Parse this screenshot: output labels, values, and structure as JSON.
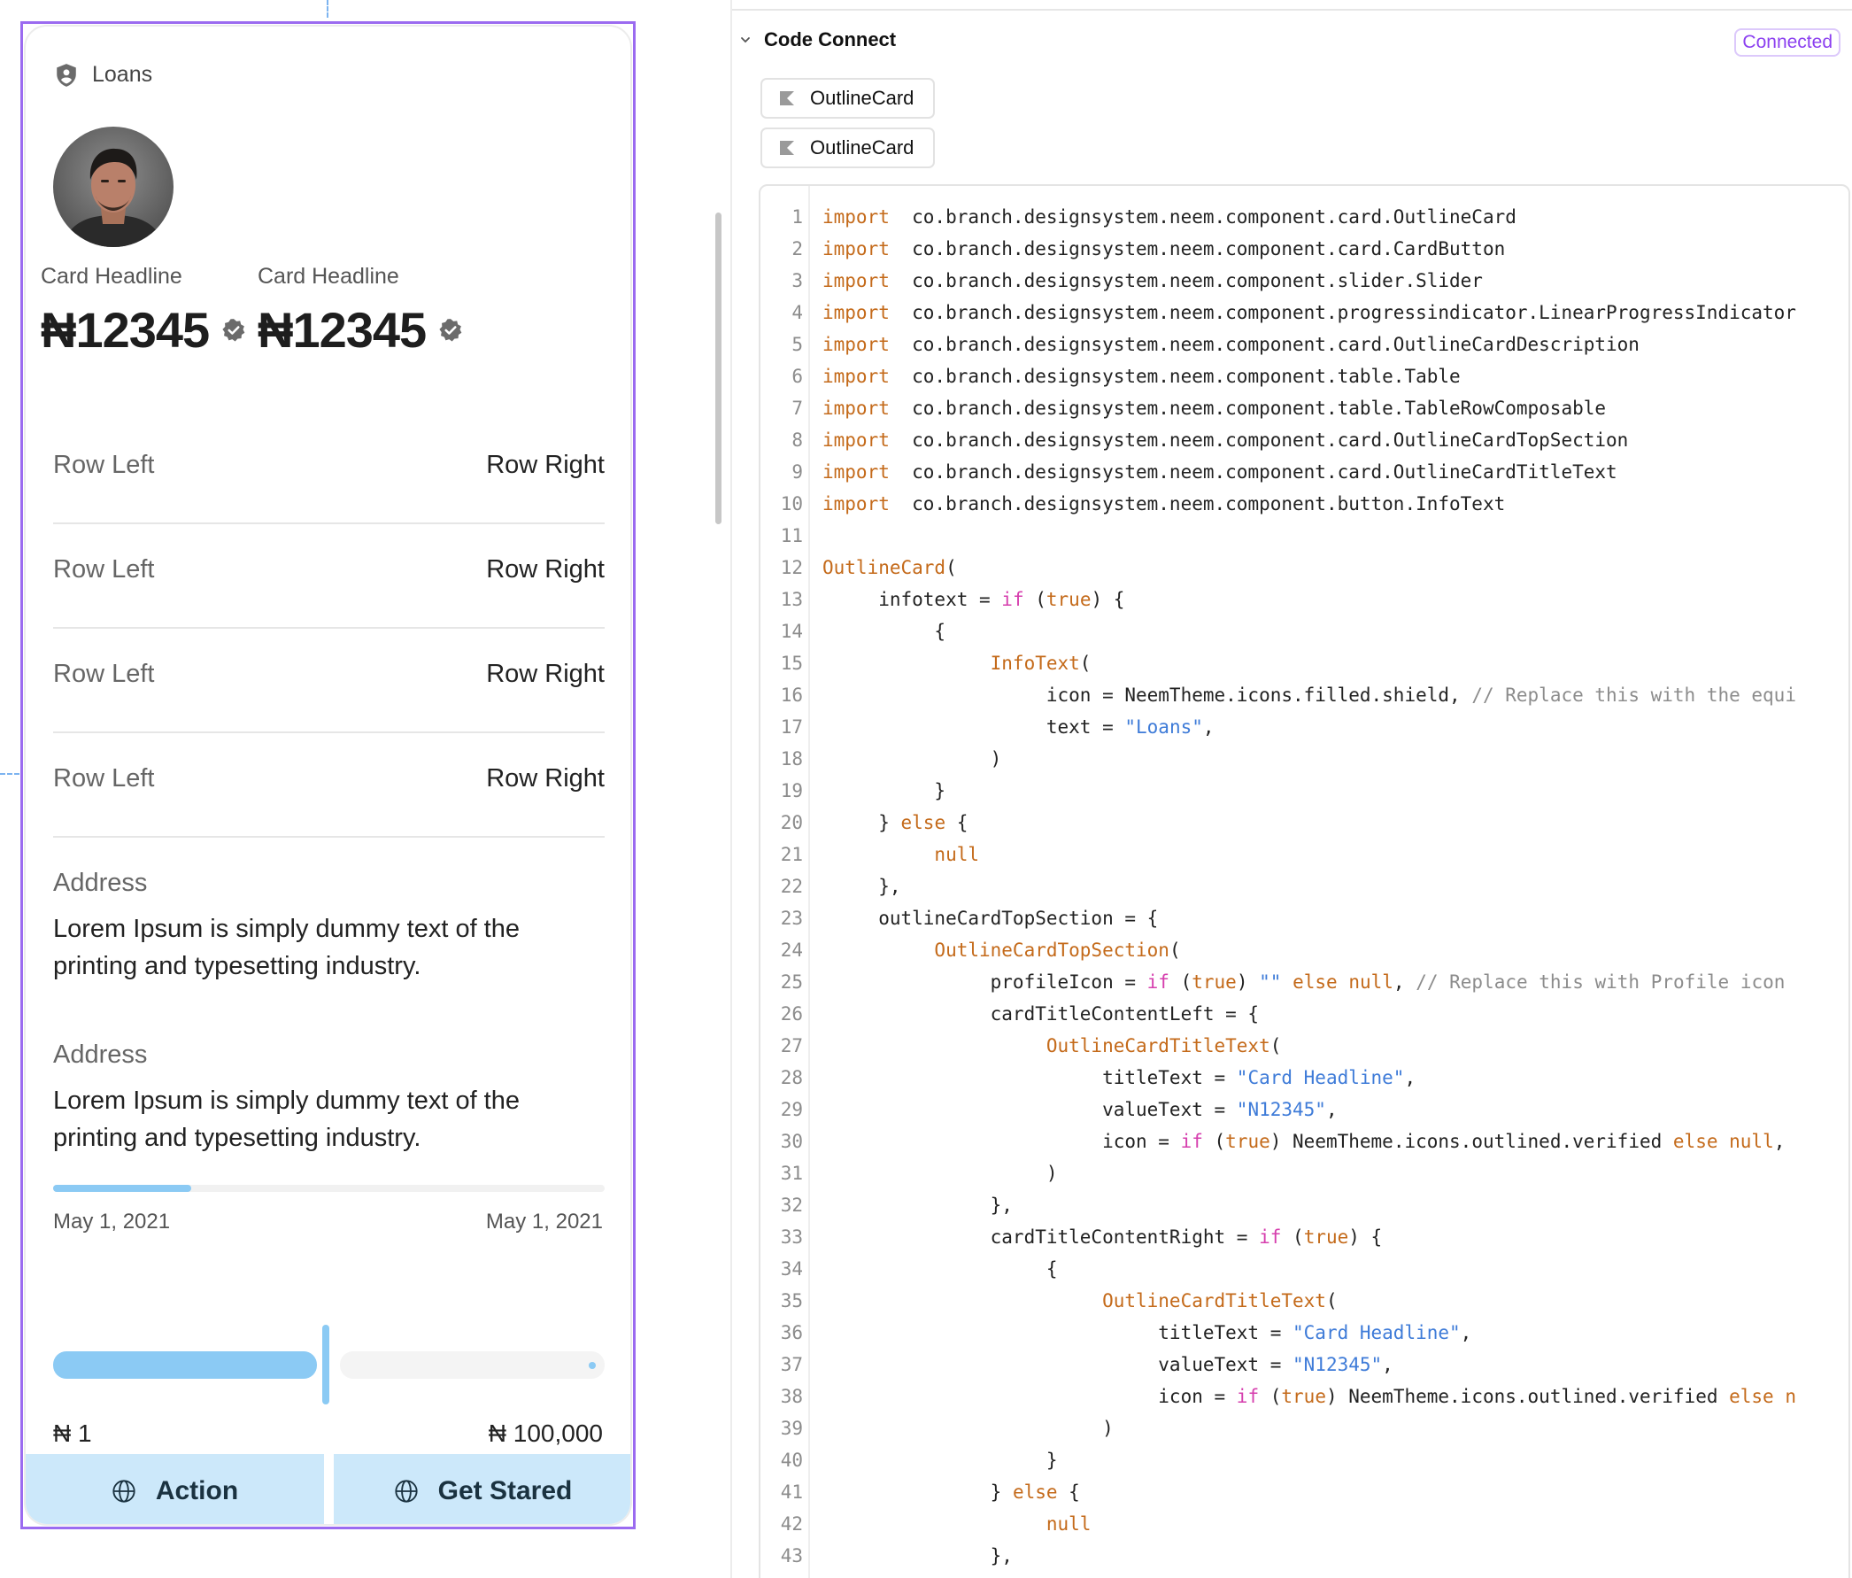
{
  "card": {
    "info_text": "Loans",
    "titles": [
      {
        "title": "Card Headline",
        "value": "₦12345"
      },
      {
        "title": "Card Headline",
        "value": "₦12345"
      }
    ],
    "rows": [
      {
        "left": "Row Left",
        "right": "Row Right"
      },
      {
        "left": "Row Left",
        "right": "Row Right"
      },
      {
        "left": "Row Left",
        "right": "Row Right"
      },
      {
        "left": "Row Left",
        "right": "Row Right"
      }
    ],
    "descriptions": [
      {
        "heading": "Address",
        "body": "Lorem Ipsum is simply dummy text of the printing and typesetting industry."
      },
      {
        "heading": "Address",
        "body": "Lorem Ipsum is simply dummy text of the printing and typesetting industry."
      }
    ],
    "progress": {
      "fraction": 0.25,
      "start_date": "May 1, 2021",
      "end_date": "May 1, 2021"
    },
    "slider": {
      "fraction": 0.5,
      "min_label": "₦ 1",
      "max_label": "₦ 100,000"
    },
    "buttons": [
      {
        "label": "Action",
        "icon": "globe-icon"
      },
      {
        "label": "Get Stared",
        "icon": "globe-icon"
      }
    ]
  },
  "panel": {
    "section_title": "Code Connect",
    "status_badge": "Connected",
    "components": [
      "OutlineCard",
      "OutlineCard"
    ]
  },
  "colors": {
    "accent_blue": "#8bcaf4",
    "button_bg": "#cce8fa",
    "selection_purple": "#9b6bf0",
    "keyword_orange": "#c46a1a",
    "keyword_pink": "#d63fae",
    "string_blue": "#3e7bd8"
  },
  "code_lines": [
    [
      [
        "kw",
        "import"
      ],
      [
        "",
        "  co.branch.designsystem.neem.component.card.OutlineCard"
      ]
    ],
    [
      [
        "kw",
        "import"
      ],
      [
        "",
        "  co.branch.designsystem.neem.component.card.CardButton"
      ]
    ],
    [
      [
        "kw",
        "import"
      ],
      [
        "",
        "  co.branch.designsystem.neem.component.slider.Slider"
      ]
    ],
    [
      [
        "kw",
        "import"
      ],
      [
        "",
        "  co.branch.designsystem.neem.component.progressindicator.LinearProgressIndicator"
      ]
    ],
    [
      [
        "kw",
        "import"
      ],
      [
        "",
        "  co.branch.designsystem.neem.component.card.OutlineCardDescription"
      ]
    ],
    [
      [
        "kw",
        "import"
      ],
      [
        "",
        "  co.branch.designsystem.neem.component.table.Table"
      ]
    ],
    [
      [
        "kw",
        "import"
      ],
      [
        "",
        "  co.branch.designsystem.neem.component.table.TableRowComposable"
      ]
    ],
    [
      [
        "kw",
        "import"
      ],
      [
        "",
        "  co.branch.designsystem.neem.component.card.OutlineCardTopSection"
      ]
    ],
    [
      [
        "kw",
        "import"
      ],
      [
        "",
        "  co.branch.designsystem.neem.component.card.OutlineCardTitleText"
      ]
    ],
    [
      [
        "kw",
        "import"
      ],
      [
        "",
        "  co.branch.designsystem.neem.component.button.InfoText"
      ]
    ],
    [],
    [
      [
        "fn",
        "OutlineCard"
      ],
      [
        "",
        "("
      ]
    ],
    [
      [
        "",
        "     infotext = "
      ],
      [
        "kp",
        "if"
      ],
      [
        "",
        " ("
      ],
      [
        "kw",
        "true"
      ],
      [
        "",
        ") {"
      ]
    ],
    [
      [
        "",
        "          {"
      ]
    ],
    [
      [
        "fn",
        "               InfoText"
      ],
      [
        "",
        "("
      ]
    ],
    [
      [
        "",
        "                    icon = NeemTheme.icons.filled.shield, "
      ],
      [
        "cm",
        "// Replace this with the equi"
      ]
    ],
    [
      [
        "",
        "                    text = "
      ],
      [
        "st",
        "\"Loans\""
      ],
      [
        "",
        ","
      ]
    ],
    [
      [
        "",
        "               )"
      ]
    ],
    [
      [
        "",
        "          }"
      ]
    ],
    [
      [
        "",
        "     } "
      ],
      [
        "kw",
        "else"
      ],
      [
        "",
        " {"
      ]
    ],
    [
      [
        "kw",
        "          null"
      ]
    ],
    [
      [
        "",
        "     },"
      ]
    ],
    [
      [
        "",
        "     outlineCardTopSection = {"
      ]
    ],
    [
      [
        "fn",
        "          OutlineCardTopSection"
      ],
      [
        "",
        "("
      ]
    ],
    [
      [
        "",
        "               profileIcon = "
      ],
      [
        "kp",
        "if"
      ],
      [
        "",
        " ("
      ],
      [
        "kw",
        "true"
      ],
      [
        "",
        ") "
      ],
      [
        "st",
        "\"\""
      ],
      [
        "",
        " "
      ],
      [
        "kw",
        "else"
      ],
      [
        "",
        " "
      ],
      [
        "kw",
        "null"
      ],
      [
        "",
        ", "
      ],
      [
        "cm",
        "// Replace this with Profile icon"
      ]
    ],
    [
      [
        "",
        "               cardTitleContentLeft = {"
      ]
    ],
    [
      [
        "fn",
        "                    OutlineCardTitleText"
      ],
      [
        "",
        "("
      ]
    ],
    [
      [
        "",
        "                         titleText = "
      ],
      [
        "st",
        "\"Card Headline\""
      ],
      [
        "",
        ","
      ]
    ],
    [
      [
        "",
        "                         valueText = "
      ],
      [
        "st",
        "\"N12345\""
      ],
      [
        "",
        ","
      ]
    ],
    [
      [
        "",
        "                         icon = "
      ],
      [
        "kp",
        "if"
      ],
      [
        "",
        " ("
      ],
      [
        "kw",
        "true"
      ],
      [
        "",
        ") NeemTheme.icons.outlined.verified "
      ],
      [
        "kw",
        "else"
      ],
      [
        "",
        " "
      ],
      [
        "kw",
        "null"
      ],
      [
        "",
        ","
      ]
    ],
    [
      [
        "",
        "                    )"
      ]
    ],
    [
      [
        "",
        "               },"
      ]
    ],
    [
      [
        "",
        "               cardTitleContentRight = "
      ],
      [
        "kp",
        "if"
      ],
      [
        "",
        " ("
      ],
      [
        "kw",
        "true"
      ],
      [
        "",
        ") {"
      ]
    ],
    [
      [
        "",
        "                    {"
      ]
    ],
    [
      [
        "fn",
        "                         OutlineCardTitleText"
      ],
      [
        "",
        "("
      ]
    ],
    [
      [
        "",
        "                              titleText = "
      ],
      [
        "st",
        "\"Card Headline\""
      ],
      [
        "",
        ","
      ]
    ],
    [
      [
        "",
        "                              valueText = "
      ],
      [
        "st",
        "\"N12345\""
      ],
      [
        "",
        ","
      ]
    ],
    [
      [
        "",
        "                              icon = "
      ],
      [
        "kp",
        "if"
      ],
      [
        "",
        " ("
      ],
      [
        "kw",
        "true"
      ],
      [
        "",
        ") NeemTheme.icons.outlined.verified "
      ],
      [
        "kw",
        "else"
      ],
      [
        "",
        " "
      ],
      [
        "kw",
        "n"
      ]
    ],
    [
      [
        "",
        "                         )"
      ]
    ],
    [
      [
        "",
        "                    }"
      ]
    ],
    [
      [
        "",
        "               } "
      ],
      [
        "kw",
        "else"
      ],
      [
        "",
        " {"
      ]
    ],
    [
      [
        "kw",
        "                    null"
      ]
    ],
    [
      [
        "",
        "               },"
      ]
    ]
  ]
}
